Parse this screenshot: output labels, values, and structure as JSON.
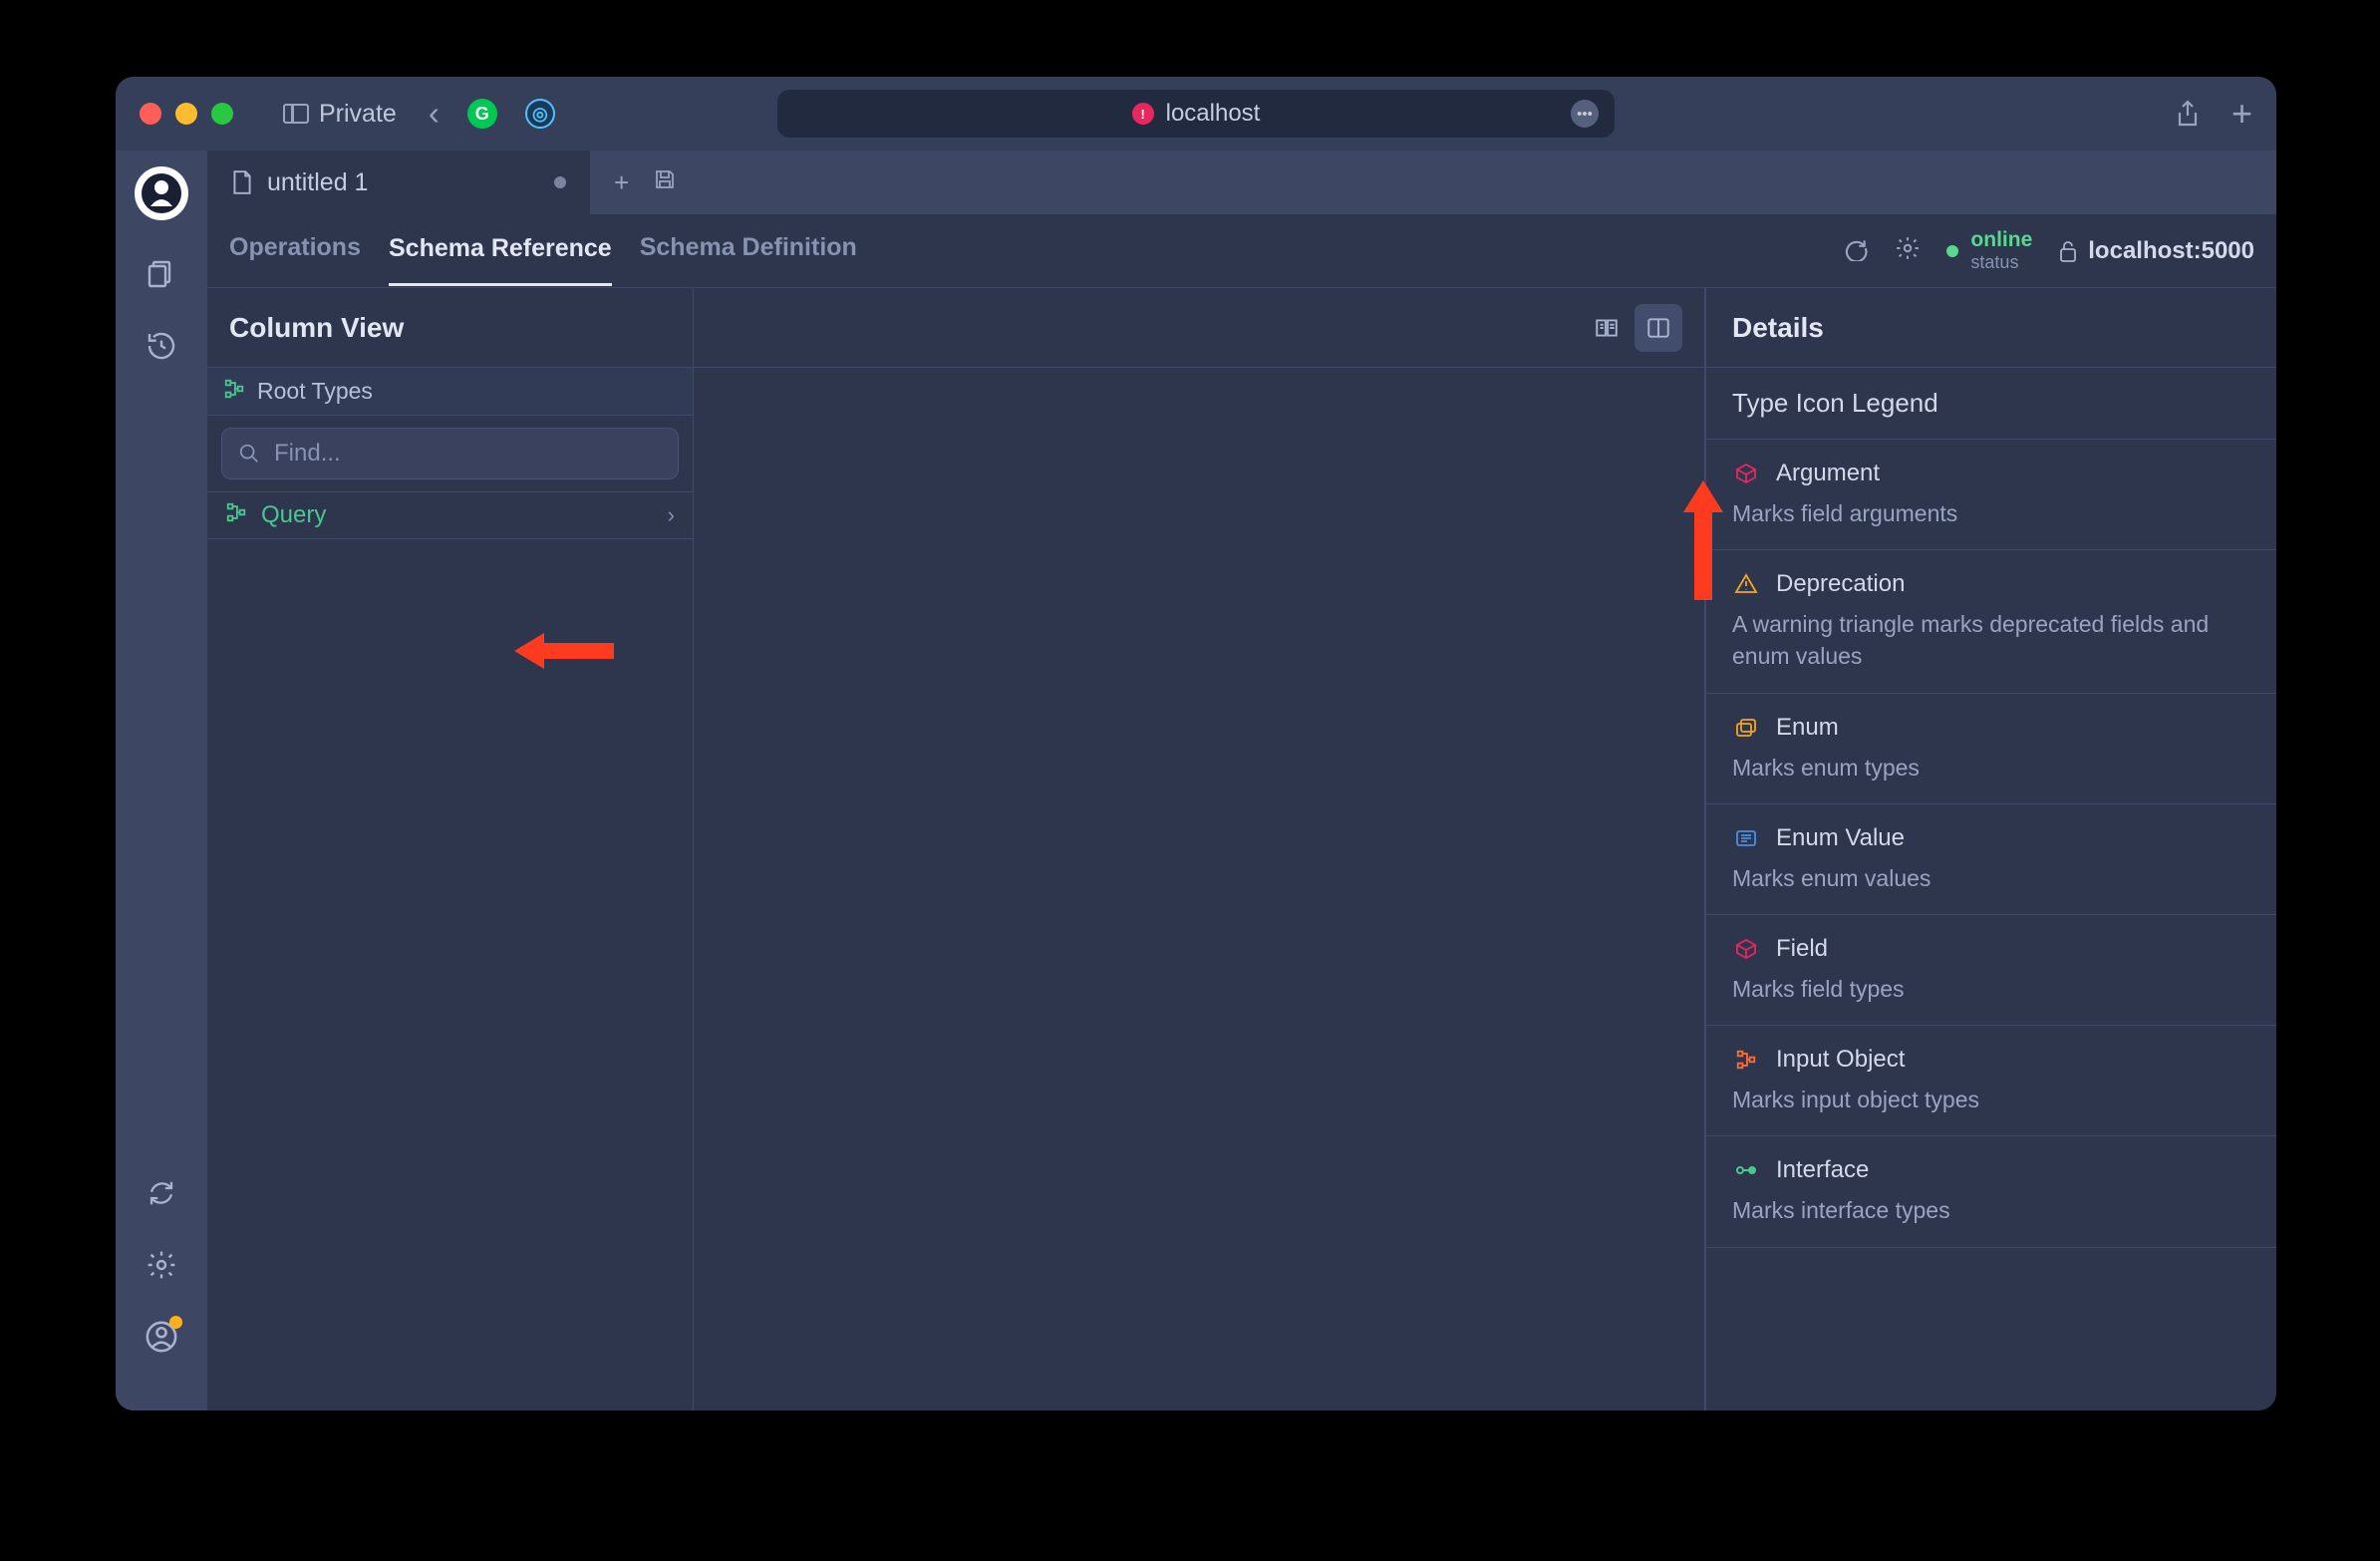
{
  "browser": {
    "private_label": "Private",
    "url_host": "localhost"
  },
  "tab": {
    "filename": "untitled 1"
  },
  "secondary_tabs": {
    "operations": "Operations",
    "schema_reference": "Schema Reference",
    "schema_definition": "Schema Definition"
  },
  "status": {
    "online": "online",
    "sub": "status",
    "endpoint": "localhost:5000"
  },
  "column_view": {
    "title": "Column View",
    "root_types": "Root Types",
    "search_placeholder": "Find...",
    "query_label": "Query"
  },
  "details": {
    "title": "Details",
    "legend_title": "Type Icon Legend",
    "items": [
      {
        "name": "Argument",
        "desc": "Marks field arguments"
      },
      {
        "name": "Deprecation",
        "desc": "A warning triangle marks deprecated fields and enum values"
      },
      {
        "name": "Enum",
        "desc": "Marks enum types"
      },
      {
        "name": "Enum Value",
        "desc": "Marks enum values"
      },
      {
        "name": "Field",
        "desc": "Marks field types"
      },
      {
        "name": "Input Object",
        "desc": "Marks input object types"
      },
      {
        "name": "Interface",
        "desc": "Marks interface types"
      }
    ]
  }
}
